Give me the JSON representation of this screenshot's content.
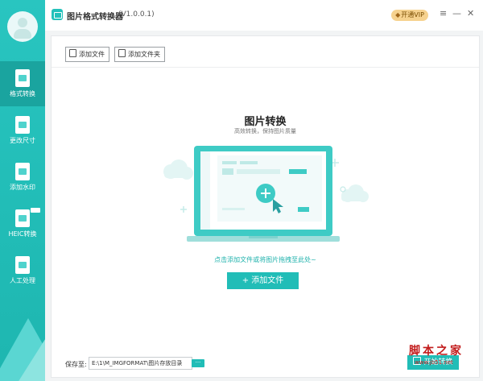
{
  "app": {
    "title": "图片格式转换器",
    "version": "(V1.0.0.1)",
    "vip_label": "开通VIP",
    "controls": {
      "menu": "≡",
      "minimize": "—",
      "close": "✕"
    }
  },
  "sidebar": {
    "items": [
      {
        "label": "格式转换",
        "icon": "format-convert-icon",
        "active": true
      },
      {
        "label": "更改尺寸",
        "icon": "resize-icon",
        "active": false
      },
      {
        "label": "添加水印",
        "icon": "watermark-icon",
        "active": false
      },
      {
        "label": "HEIC转换",
        "icon": "heic-convert-icon",
        "active": false
      },
      {
        "label": "人工处理",
        "icon": "manual-process-icon",
        "active": false
      }
    ]
  },
  "toolbar": {
    "add_file": "添加文件",
    "add_folder": "添加文件夹"
  },
  "hero": {
    "title": "图片转换",
    "subtitle": "高效转换，保持图片质量",
    "hint": "点击添加文件或将图片拖拽至此处~",
    "add_button": "+ 添加文件"
  },
  "footer": {
    "save_label": "保存至:",
    "save_path": "E:\\1\\M_IMGFORMAT\\图片存放目录",
    "browse": "···",
    "start_button": "开始转换"
  },
  "watermark": {
    "text": "脚本之家",
    "sub": "www.jb51.net"
  },
  "colors": {
    "accent": "#21bdb7",
    "sidebar": "#29c5c0",
    "vip": "#f6d28f"
  }
}
